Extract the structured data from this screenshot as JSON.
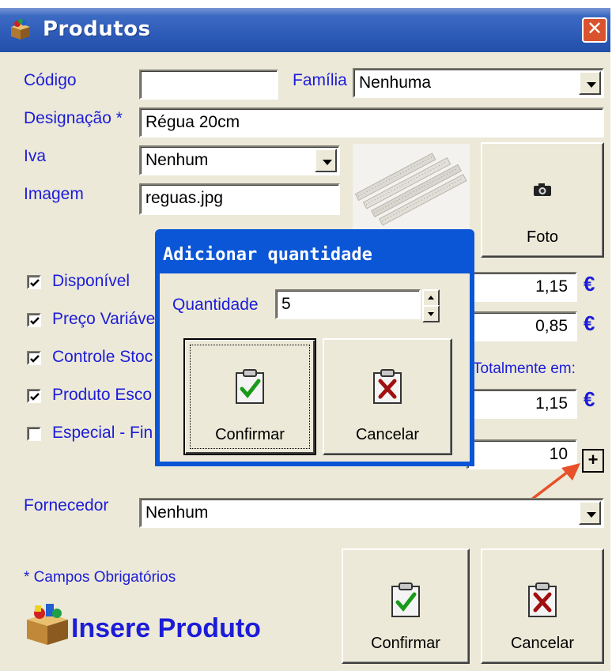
{
  "window": {
    "title": "Produtos",
    "close_glyph": "✕"
  },
  "form": {
    "codigo_label": "Código",
    "codigo_value": "",
    "familia_label": "Família",
    "familia_value": "Nenhuma",
    "designacao_label": "Designação *",
    "designacao_value": "Régua 20cm",
    "iva_label": "Iva",
    "iva_value": "Nenhum",
    "imagem_label": "Imagem",
    "imagem_value": "reguas.jpg",
    "foto_button": "Foto",
    "checkboxes": [
      {
        "label": "Disponível",
        "checked": true
      },
      {
        "label": "Preço Variáve",
        "checked": true
      },
      {
        "label": "Controle Stoc",
        "checked": true
      },
      {
        "label": "Produto Esco",
        "checked": true
      },
      {
        "label": "Especial - Fin",
        "checked": false
      }
    ],
    "price1": "1,15",
    "price2": "0,85",
    "totalmente_label": "Totalmente em:",
    "price3": "1,15",
    "stock_value": "10",
    "euro_symbol": "€",
    "plus_button": "+",
    "fornecedor_label": "Fornecedor",
    "fornecedor_value": "Nenhum",
    "required_note": "* Campos Obrigatórios",
    "brand_text": "Insere Produto",
    "confirm_button": "Confirmar",
    "cancel_button": "Cancelar"
  },
  "dialog": {
    "title": "Adicionar quantidade",
    "quantidade_label": "Quantidade",
    "quantidade_value": "5",
    "confirm_button": "Confirmar",
    "cancel_button": "Cancelar"
  },
  "colors": {
    "label_blue": "#1c1cd8",
    "titlebar_blue": "#2d5bb8",
    "dialog_blue": "#0a56d6",
    "arrow": "#e8502a",
    "check_green": "#1a9a1a",
    "cross_red": "#a01010"
  }
}
